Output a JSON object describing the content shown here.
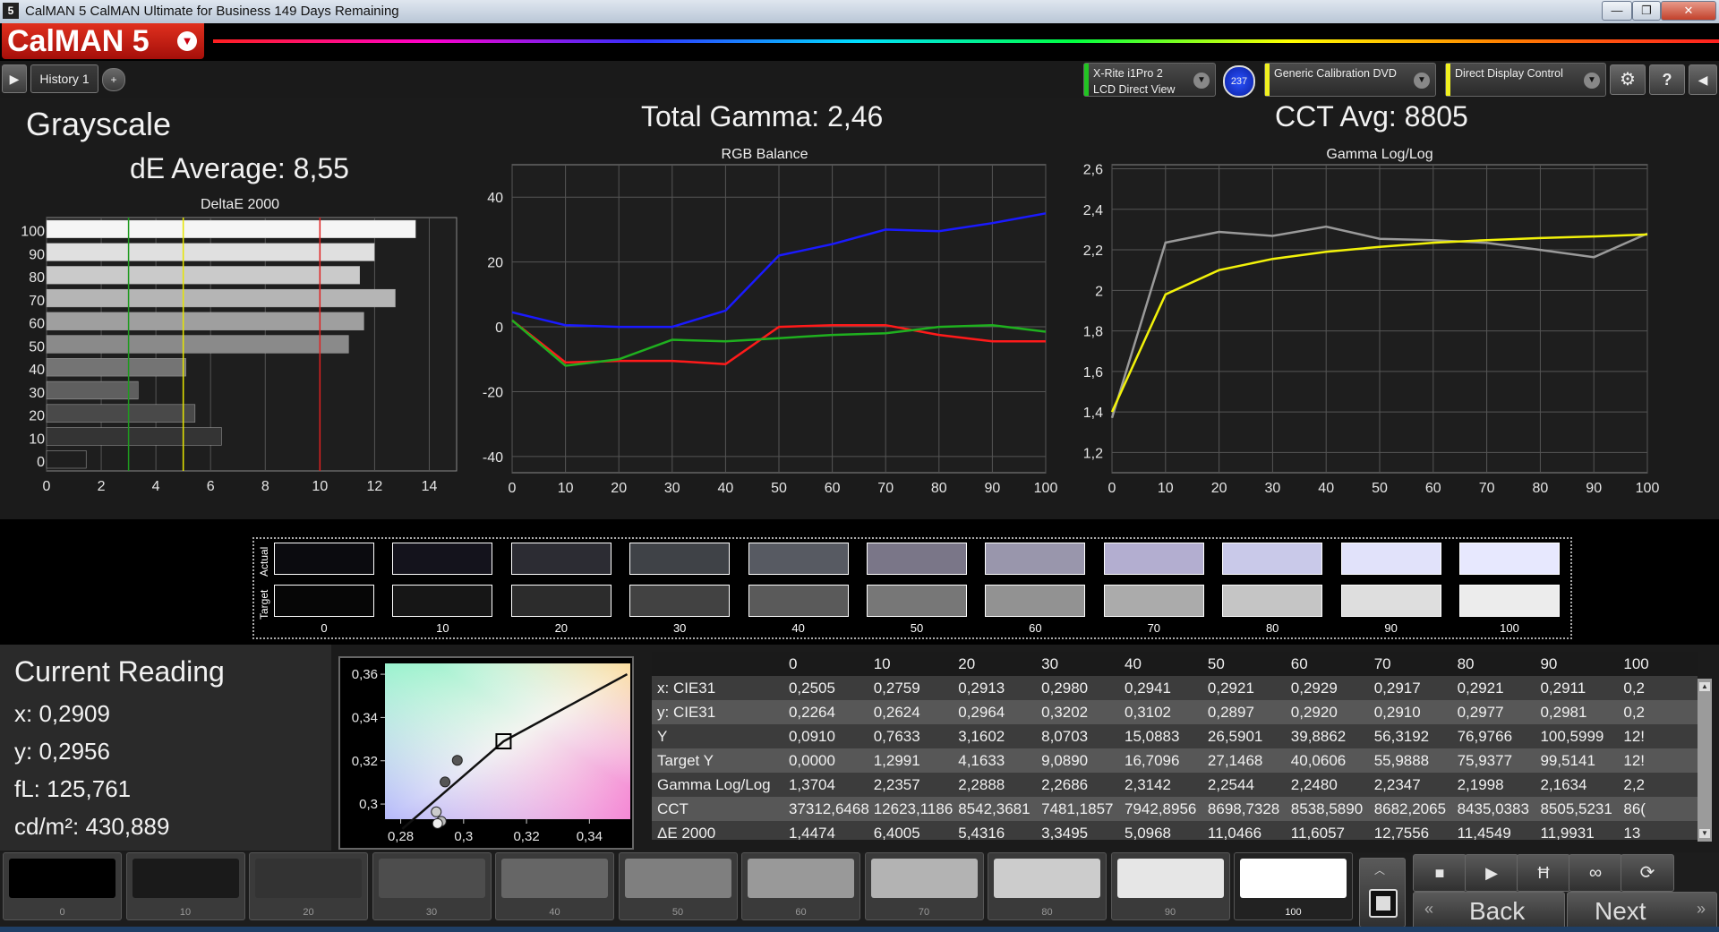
{
  "window": {
    "title": "CalMAN 5 CalMAN Ultimate for Business 149 Days Remaining",
    "app_icon": "5",
    "minimize": "—",
    "restore": "❐",
    "close": "✕"
  },
  "logo": {
    "text": "CalMAN 5"
  },
  "toolbar": {
    "history_tab": "History 1",
    "add_tab": "+",
    "devices": [
      {
        "line1": "X-Rite i1Pro 2",
        "line2": "LCD Direct View",
        "color": "#22c422"
      },
      {
        "line1": "Generic Calibration DVD",
        "line2": "",
        "color": "#f0f020"
      },
      {
        "line1": "Direct Display Control",
        "line2": "",
        "color": "#f0f020"
      }
    ],
    "badge": "237",
    "settings_icon": "gear-icon",
    "help_label": "?"
  },
  "header": {
    "title": "Grayscale",
    "de_average": "dE Average: 8,55",
    "total_gamma": "Total Gamma: 2,46",
    "cct_avg": "CCT Avg: 8805"
  },
  "chart_data": [
    {
      "type": "bar",
      "title": "DeltaE 2000",
      "orientation": "horizontal",
      "categories": [
        "0",
        "10",
        "20",
        "30",
        "40",
        "50",
        "60",
        "70",
        "80",
        "90",
        "100"
      ],
      "values": [
        1.4474,
        6.4005,
        5.4316,
        3.3495,
        5.0968,
        11.0466,
        11.6057,
        12.7556,
        11.4549,
        11.9931,
        13.5
      ],
      "xlim": [
        0,
        15
      ],
      "xticks": [
        "0",
        "2",
        "4",
        "6",
        "8",
        "10",
        "12",
        "14"
      ],
      "reference_lines": [
        {
          "value": 3,
          "color": "#1f9a1f"
        },
        {
          "value": 5,
          "color": "#e6e600"
        },
        {
          "value": 10,
          "color": "#e02020"
        }
      ]
    },
    {
      "type": "line",
      "title": "RGB Balance",
      "x": [
        0,
        10,
        20,
        30,
        40,
        50,
        60,
        70,
        80,
        90,
        100
      ],
      "xticks": [
        "0",
        "10",
        "20",
        "30",
        "40",
        "50",
        "60",
        "70",
        "80",
        "90",
        "100"
      ],
      "yticks": [
        "40",
        "20",
        "0",
        "-20",
        "-40"
      ],
      "ylim": [
        -45,
        50
      ],
      "series": [
        {
          "color": "#ff1a1a",
          "values": [
            2,
            -11,
            -10.5,
            -10.5,
            -11.5,
            0,
            0.5,
            0.5,
            -2.5,
            -4.5,
            -4.5
          ]
        },
        {
          "color": "#1fb01f",
          "values": [
            2,
            -12,
            -10,
            -4,
            -4.5,
            -3.5,
            -2.5,
            -2,
            0,
            0.5,
            -1.5
          ]
        },
        {
          "color": "#1a1aff",
          "values": [
            4.5,
            0.5,
            0,
            0,
            5,
            22,
            25.5,
            30,
            29.5,
            32,
            35
          ]
        }
      ]
    },
    {
      "type": "line",
      "title": "Gamma Log/Log",
      "x": [
        0,
        10,
        20,
        30,
        40,
        50,
        60,
        70,
        80,
        90,
        100
      ],
      "xticks": [
        "0",
        "10",
        "20",
        "30",
        "40",
        "50",
        "60",
        "70",
        "80",
        "90",
        "100"
      ],
      "yticks": [
        "2,6",
        "2,4",
        "2,2",
        "2",
        "1,8",
        "1,6",
        "1,4",
        "1,2"
      ],
      "ylim": [
        1.1,
        2.62
      ],
      "series": [
        {
          "color": "#9a9a9a",
          "values": [
            1.3704,
            2.2357,
            2.2888,
            2.2686,
            2.3142,
            2.2544,
            2.248,
            2.2347,
            2.1998,
            2.1634,
            2.28
          ]
        },
        {
          "color": "#f2f20a",
          "values": [
            1.4,
            1.98,
            2.1,
            2.155,
            2.19,
            2.215,
            2.235,
            2.248,
            2.258,
            2.266,
            2.276
          ],
          "curve": true
        }
      ]
    },
    {
      "type": "scatter",
      "title": "",
      "xticks": [
        "0,28",
        "0,3",
        "0,32",
        "0,34"
      ],
      "yticks": [
        "0,36",
        "0,34",
        "0,32",
        "0,3"
      ],
      "xlim": [
        0.275,
        0.353
      ],
      "ylim": [
        0.293,
        0.365
      ],
      "target": {
        "x": 0.3127,
        "y": 0.329
      },
      "points": [
        {
          "x": 0.2913,
          "y": 0.2964,
          "color": "#cccccc"
        },
        {
          "x": 0.2929,
          "y": 0.292,
          "color": "#bbbbbb"
        },
        {
          "x": 0.2941,
          "y": 0.3102,
          "color": "#555555"
        },
        {
          "x": 0.298,
          "y": 0.3202,
          "color": "#555555"
        },
        {
          "x": 0.2917,
          "y": 0.291,
          "color": "#eeeeee"
        }
      ]
    }
  ],
  "swatches": {
    "actual_label": "Actual",
    "target_label": "Target",
    "labels": [
      "0",
      "10",
      "20",
      "30",
      "40",
      "50",
      "60",
      "70",
      "80",
      "90",
      "100"
    ],
    "actual": [
      "#0b0b0f",
      "#14131c",
      "#2c2c33",
      "#3f4247",
      "#575a62",
      "#7a7688",
      "#9996ac",
      "#b3aed0",
      "#c9c9e9",
      "#e1e2fa",
      "#e7e8fe"
    ],
    "target": [
      "#060606",
      "#161616",
      "#2c2c2c",
      "#424242",
      "#5a5a5a",
      "#777777",
      "#929292",
      "#ababab",
      "#c5c5c5",
      "#dedede",
      "#ececec"
    ]
  },
  "current_reading": {
    "title": "Current Reading",
    "x": "x: 0,2909",
    "y": "y: 0,2956",
    "fl": "fL: 125,761",
    "cdm2": "cd/m²: 430,889"
  },
  "table": {
    "columns": [
      "0",
      "10",
      "20",
      "30",
      "40",
      "50",
      "60",
      "70",
      "80",
      "90",
      "100"
    ],
    "rows": [
      {
        "label": "x: CIE31",
        "values": [
          "0,2505",
          "0,2759",
          "0,2913",
          "0,2980",
          "0,2941",
          "0,2921",
          "0,2929",
          "0,2917",
          "0,2921",
          "0,2911",
          "0,2"
        ]
      },
      {
        "label": "y: CIE31",
        "values": [
          "0,2264",
          "0,2624",
          "0,2964",
          "0,3202",
          "0,3102",
          "0,2897",
          "0,2920",
          "0,2910",
          "0,2977",
          "0,2981",
          "0,2"
        ]
      },
      {
        "label": "Y",
        "values": [
          "0,0910",
          "0,7633",
          "3,1602",
          "8,0703",
          "15,0883",
          "26,5901",
          "39,8862",
          "56,3192",
          "76,9766",
          "100,5999",
          "12!"
        ]
      },
      {
        "label": "Target Y",
        "values": [
          "0,0000",
          "1,2991",
          "4,1633",
          "9,0890",
          "16,7096",
          "27,1468",
          "40,0606",
          "55,9888",
          "75,9377",
          "99,5141",
          "12!"
        ]
      },
      {
        "label": "Gamma Log/Log",
        "values": [
          "1,3704",
          "2,2357",
          "2,2888",
          "2,2686",
          "2,3142",
          "2,2544",
          "2,2480",
          "2,2347",
          "2,1998",
          "2,1634",
          "2,2"
        ]
      },
      {
        "label": "CCT",
        "values": [
          "37312,6468",
          "12623,1186",
          "8542,3681",
          "7481,1857",
          "7942,8956",
          "8698,7328",
          "8538,5890",
          "8682,2065",
          "8435,0383",
          "8505,5231",
          "86("
        ]
      },
      {
        "label": "ΔE 2000",
        "values": [
          "1,4474",
          "6,4005",
          "5,4316",
          "3,3495",
          "5,0968",
          "11,0466",
          "11,6057",
          "12,7556",
          "11,4549",
          "11,9931",
          "13"
        ]
      }
    ]
  },
  "bottom": {
    "swatches": [
      {
        "label": "0",
        "color": "#000000"
      },
      {
        "label": "10",
        "color": "#1a1a1a"
      },
      {
        "label": "20",
        "color": "#333333"
      },
      {
        "label": "30",
        "color": "#4d4d4d"
      },
      {
        "label": "40",
        "color": "#666666"
      },
      {
        "label": "50",
        "color": "#7f7f7f"
      },
      {
        "label": "60",
        "color": "#999999"
      },
      {
        "label": "70",
        "color": "#b3b3b3"
      },
      {
        "label": "80",
        "color": "#cccccc"
      },
      {
        "label": "90",
        "color": "#e6e6e6"
      },
      {
        "label": "100",
        "color": "#ffffff"
      }
    ],
    "back_label": "Back",
    "next_label": "Next"
  }
}
